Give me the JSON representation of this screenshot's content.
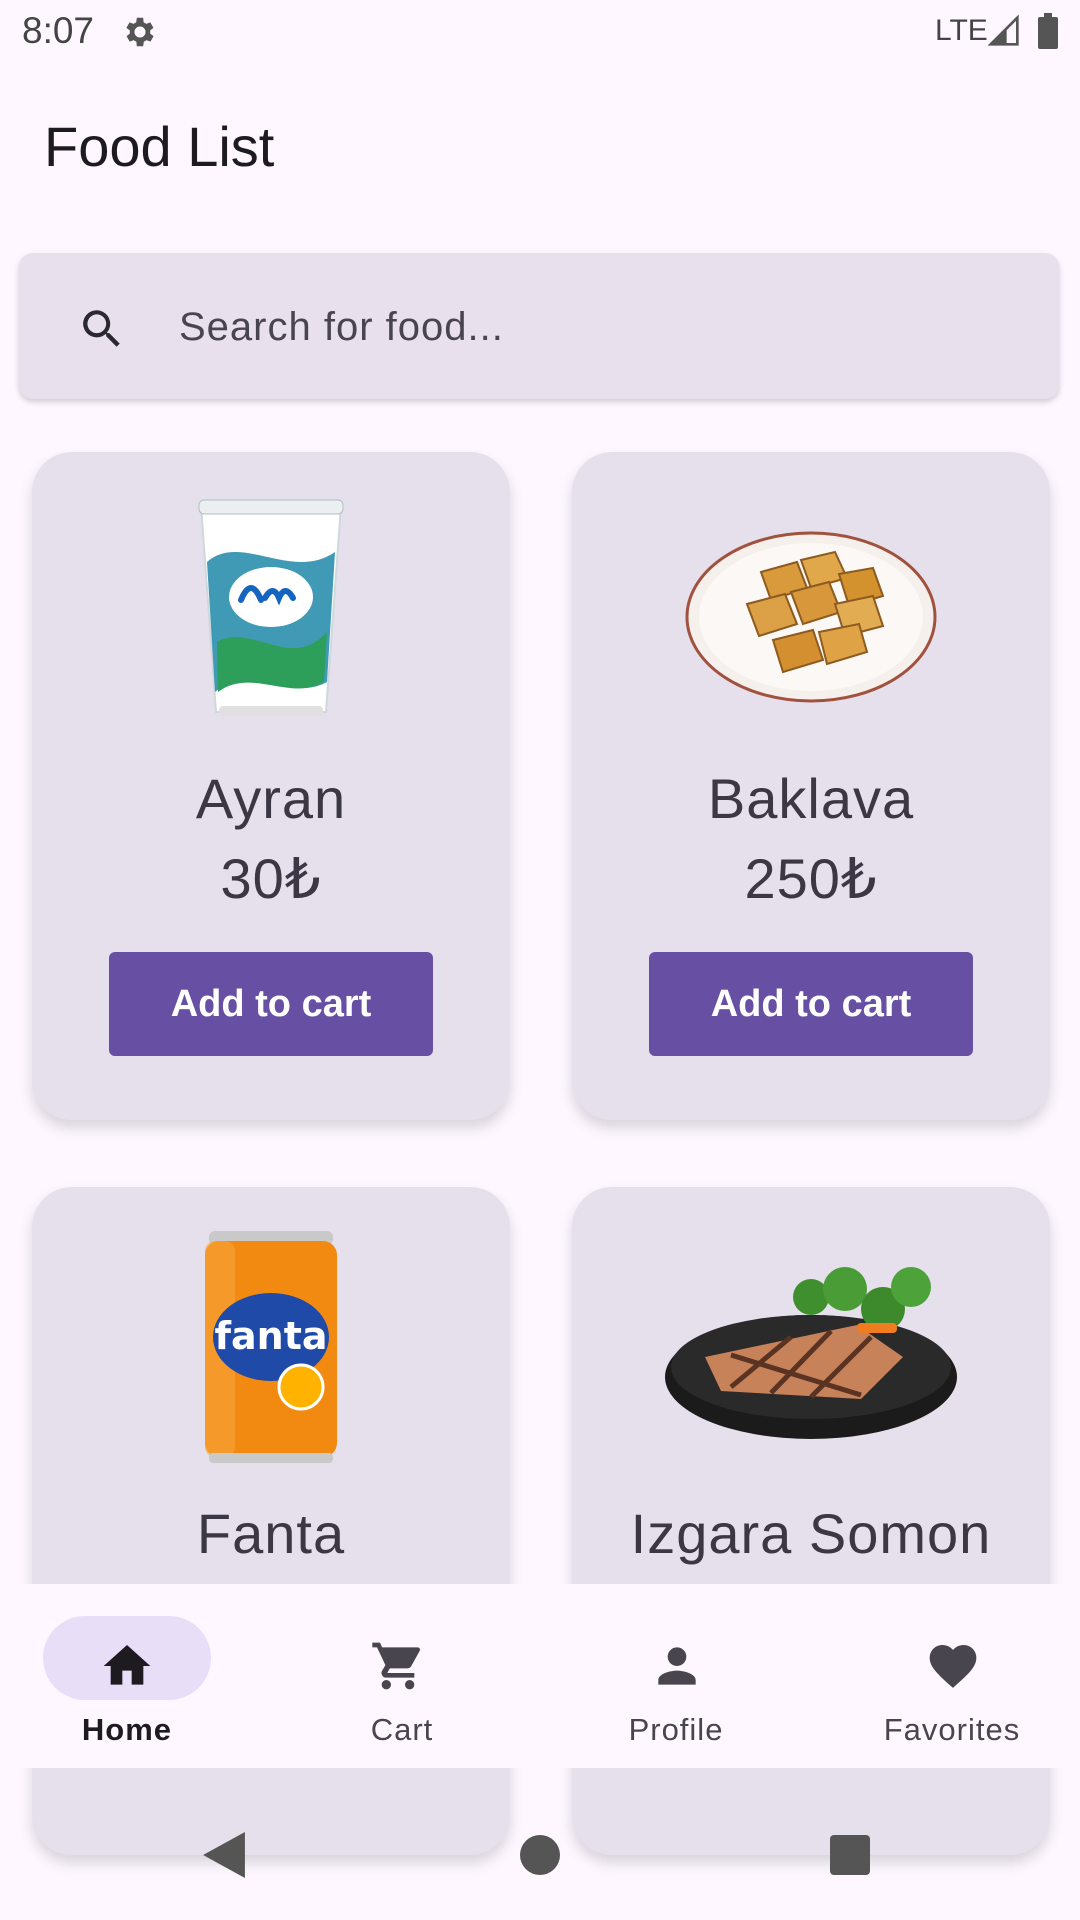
{
  "status_bar": {
    "time": "8:07",
    "network": "LTE",
    "icons": [
      "gear-icon",
      "signal-icon",
      "battery-icon"
    ]
  },
  "page": {
    "title": "Food List"
  },
  "search": {
    "placeholder": "Search for food...",
    "value": "",
    "icon": "search-icon"
  },
  "foods": [
    {
      "name": "Ayran",
      "price": "30₺",
      "button_label": "Add to cart",
      "image": "ayran-cup-image"
    },
    {
      "name": "Baklava",
      "price": "250₺",
      "button_label": "Add to cart",
      "image": "baklava-plate-image"
    },
    {
      "name": "Fanta",
      "image": "fanta-can-image"
    },
    {
      "name": "Izgara Somon",
      "image": "grilled-salmon-image"
    }
  ],
  "bottom_nav": {
    "items": [
      {
        "label": "Home",
        "icon": "home-icon",
        "active": true
      },
      {
        "label": "Cart",
        "icon": "cart-icon",
        "active": false
      },
      {
        "label": "Profile",
        "icon": "person-icon",
        "active": false
      },
      {
        "label": "Favorites",
        "icon": "heart-icon",
        "active": false
      }
    ]
  },
  "colors": {
    "background": "#fef7ff",
    "card": "#e6e0ec",
    "primary": "#6750a4",
    "nav_active_pill": "#e8def8",
    "on_surface": "#1d1b20"
  }
}
